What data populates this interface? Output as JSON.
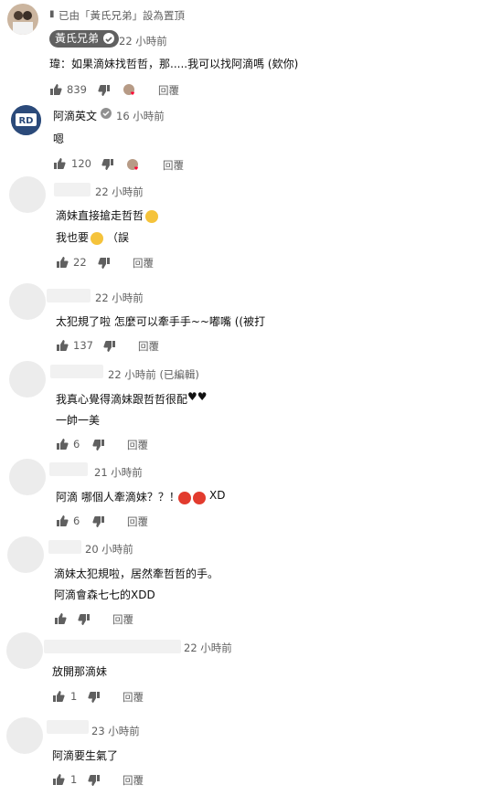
{
  "pinned_note": "已由「黃氏兄弟」設為置頂",
  "comments": [
    {
      "author": "黃氏兄弟",
      "time": "22 小時前",
      "lines": [
        "瑋：如果滴妹找哲哲，那.....我可以找阿滴嗎 (欸你)"
      ],
      "likes": "839",
      "reply": "回覆"
    },
    {
      "author": "阿滴英文",
      "time": "16 小時前",
      "lines": [
        "嗯"
      ],
      "likes": "120",
      "reply": "回覆"
    },
    {
      "author": "",
      "time": "22 小時前",
      "lines": [
        "滴妹直接搶走哲哲",
        "我也要",
        "（誤"
      ],
      "likes": "22",
      "reply": "回覆"
    },
    {
      "author": "",
      "time": "22 小時前",
      "lines": [
        "太犯規了啦 怎麼可以牽手手~~嘟嘴 ((被打"
      ],
      "likes": "137",
      "reply": "回覆"
    },
    {
      "author": "",
      "time": "22 小時前 (已編輯)",
      "lines": [
        "我真心覺得滴妹跟哲哲很配",
        "一帥一美"
      ],
      "likes": "6",
      "reply": "回覆"
    },
    {
      "author": "",
      "time": "21 小時前",
      "lines": [
        "阿滴 哪個人牽滴妹？？！",
        "XD"
      ],
      "likes": "6",
      "reply": "回覆"
    },
    {
      "author": "",
      "time": "20 小時前",
      "lines": [
        "滴妹太犯規啦，居然牽哲哲的手。",
        "阿滴會森七七的XDD"
      ],
      "likes": "",
      "reply": "回覆"
    },
    {
      "author": "",
      "time": "22 小時前",
      "lines": [
        "放開那滴妹"
      ],
      "likes": "1",
      "reply": "回覆"
    },
    {
      "author": "",
      "time": "23 小時前",
      "lines": [
        "阿滴要生氣了"
      ],
      "likes": "1",
      "reply": "回覆"
    }
  ],
  "icons": {
    "like": "thumbs-up-icon",
    "dislike": "thumbs-down-icon",
    "pin": "pin-icon",
    "verified": "verified-check-icon",
    "hearted": "creator-heart-icon"
  },
  "colors": {
    "text": "#0f0f0f",
    "muted": "#606060",
    "badge_bg": "#606060",
    "heart": "#ff0033",
    "brand_rd": "#2b4a7a"
  }
}
